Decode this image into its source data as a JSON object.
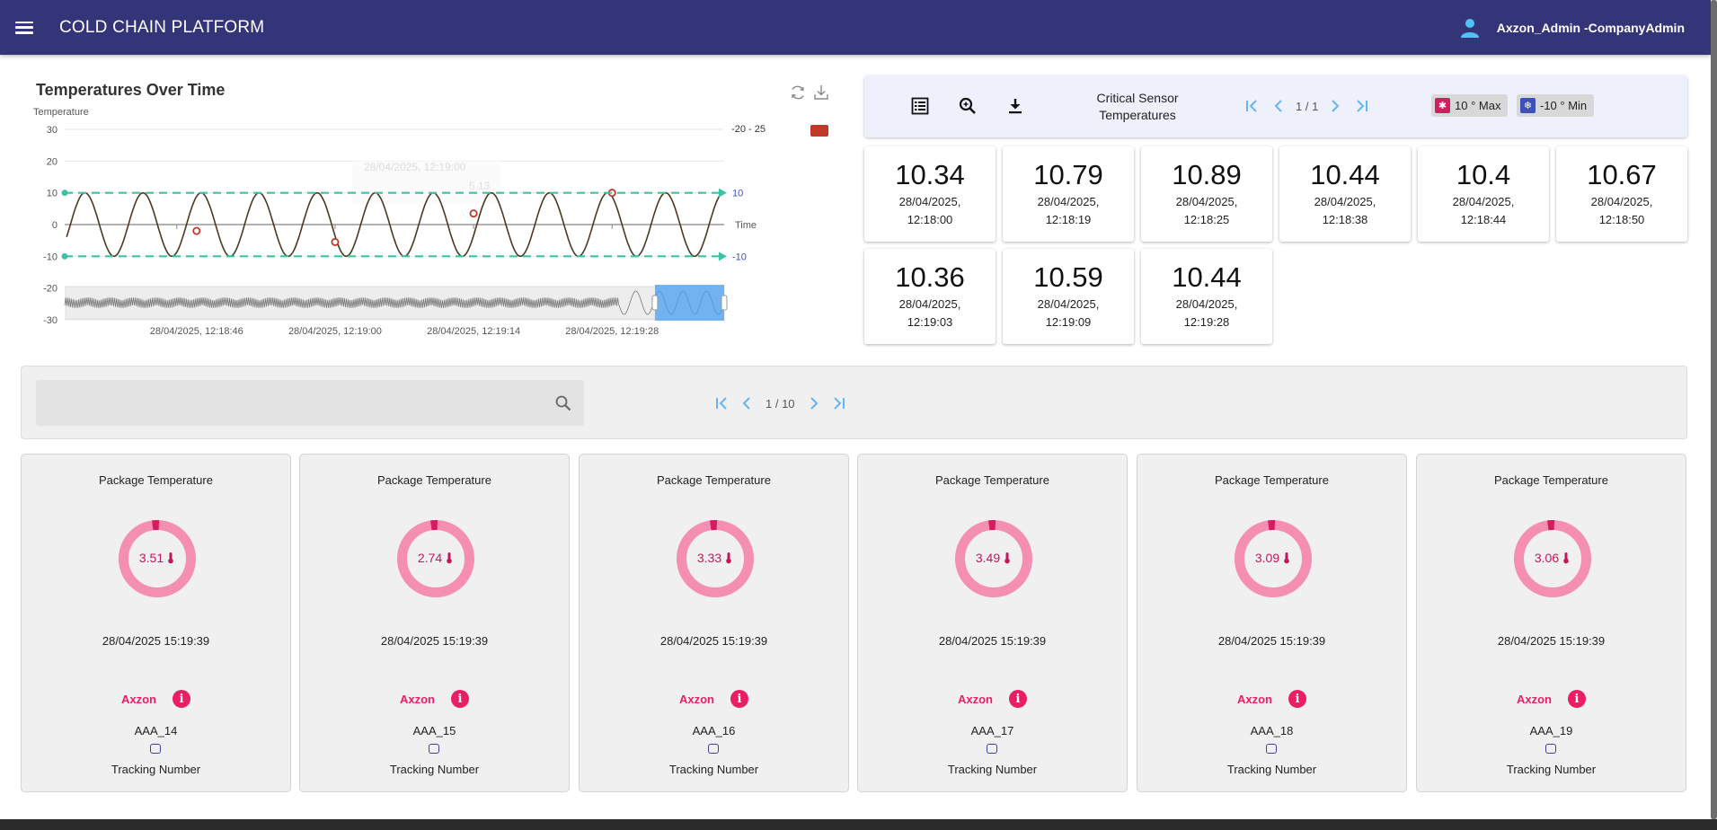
{
  "appbar": {
    "title": "COLD CHAIN PLATFORM",
    "user_name": "Axzon_Admin -CompanyAdmin",
    "color": "#343579"
  },
  "chart_panel": {
    "title": "Temperatures Over Time",
    "range_legend": "-20 - 25",
    "range_legend_color": "#c0392b",
    "tools": [
      "refresh-icon",
      "download-icon"
    ]
  },
  "chart_data": {
    "type": "line",
    "title": "Temperatures Over Time",
    "ylabel": "Temperature",
    "xlabel": "Time",
    "ylim": [
      -30,
      30
    ],
    "yticks": [
      30,
      20,
      10,
      0,
      -10,
      -20,
      -30
    ],
    "xticks": [
      "28/04/2025, 12:18:46",
      "28/04/2025, 12:19:00",
      "28/04/2025, 12:19:14",
      "28/04/2025, 12:19:28"
    ],
    "series": [
      {
        "color": "#4a3a22",
        "shape": "sinusoidal",
        "amplitude": 10,
        "cycles": 11.3
      }
    ],
    "markers": [
      {
        "x": 0.2,
        "y": -2
      },
      {
        "x": 0.41,
        "y": -5.5
      },
      {
        "x": 0.62,
        "y": 3.5
      },
      {
        "x": 0.83,
        "y": 10
      }
    ],
    "markline_max": {
      "value": 10,
      "label": "10",
      "color": "#3ec2a4"
    },
    "markline_min": {
      "value": -10,
      "label": "-10",
      "color": "#3ec2a4"
    },
    "ghost_tooltip": {
      "time": "28/04/2025, 12:19:00",
      "value": "5.13"
    },
    "grid": true,
    "data_zoom": {
      "start": 0.895,
      "end": 1.0
    }
  },
  "critical": {
    "title": "Critical Sensor Temperatures",
    "page_label": "1 / 1",
    "max_chip": "10 ° Max",
    "min_chip": "-10 ° Min",
    "max_color": "#d81b60",
    "min_color": "#3f51b5",
    "sensors": [
      {
        "value": "10.34",
        "date": "28/04/2025,",
        "time": "12:18:00"
      },
      {
        "value": "10.79",
        "date": "28/04/2025,",
        "time": "12:18:19"
      },
      {
        "value": "10.89",
        "date": "28/04/2025,",
        "time": "12:18:25"
      },
      {
        "value": "10.44",
        "date": "28/04/2025,",
        "time": "12:18:38"
      },
      {
        "value": "10.4",
        "date": "28/04/2025,",
        "time": "12:18:44"
      },
      {
        "value": "10.67",
        "date": "28/04/2025,",
        "time": "12:18:50"
      },
      {
        "value": "10.36",
        "date": "28/04/2025,",
        "time": "12:19:03"
      },
      {
        "value": "10.59",
        "date": "28/04/2025,",
        "time": "12:19:09"
      },
      {
        "value": "10.44",
        "date": "28/04/2025,",
        "time": "12:19:28"
      }
    ]
  },
  "search": {
    "value": "",
    "placeholder": "",
    "page_label": "1 / 10"
  },
  "packages": [
    {
      "title": "Package Temperature",
      "value": "3.51",
      "date": "28/04/2025 15:19:39",
      "company": "Axzon",
      "id": "AAA_14",
      "tracking_label": "Tracking Number",
      "fraction": 0.03
    },
    {
      "title": "Package Temperature",
      "value": "2.74",
      "date": "28/04/2025 15:19:39",
      "company": "Axzon",
      "id": "AAA_15",
      "tracking_label": "Tracking Number",
      "fraction": 0.03
    },
    {
      "title": "Package Temperature",
      "value": "3.33",
      "date": "28/04/2025 15:19:39",
      "company": "Axzon",
      "id": "AAA_16",
      "tracking_label": "Tracking Number",
      "fraction": 0.03
    },
    {
      "title": "Package Temperature",
      "value": "3.49",
      "date": "28/04/2025 15:19:39",
      "company": "Axzon",
      "id": "AAA_17",
      "tracking_label": "Tracking Number",
      "fraction": 0.03
    },
    {
      "title": "Package Temperature",
      "value": "3.09",
      "date": "28/04/2025 15:19:39",
      "company": "Axzon",
      "id": "AAA_18",
      "tracking_label": "Tracking Number",
      "fraction": 0.03
    },
    {
      "title": "Package Temperature",
      "value": "3.06",
      "date": "28/04/2025 15:19:39",
      "company": "Axzon",
      "id": "AAA_19",
      "tracking_label": "Tracking Number",
      "fraction": 0.03
    }
  ]
}
